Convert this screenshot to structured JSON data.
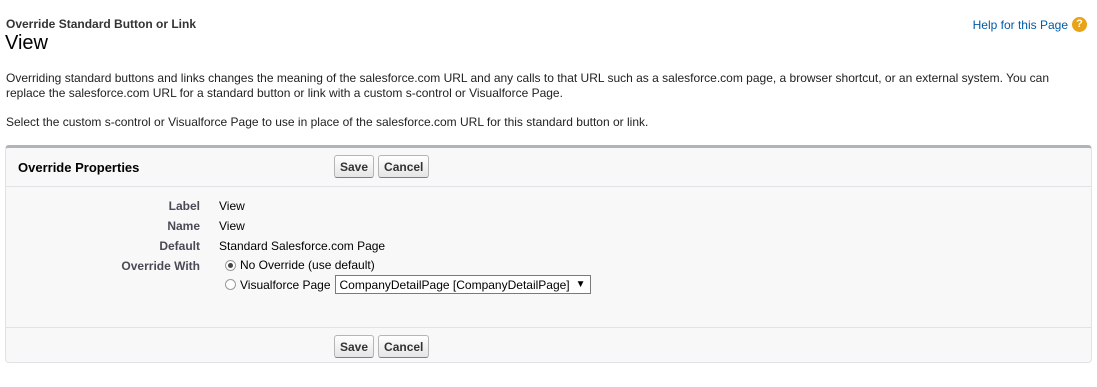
{
  "header": {
    "subtitle": "Override Standard Button or Link",
    "title": "View",
    "help_link": "Help for this Page",
    "help_icon": "question-circle-icon"
  },
  "description": {
    "paragraph1": "Overriding standard buttons and links changes the meaning of the salesforce.com URL and any calls to that URL such as a salesforce.com page, a browser shortcut, or an external system. You can replace the salesforce.com URL for a standard button or link with a custom s-control or Visualforce Page.",
    "paragraph2": "Select the custom s-control or Visualforce Page to use in place of the salesforce.com URL for this standard button or link."
  },
  "panel": {
    "title": "Override Properties",
    "save_label": "Save",
    "cancel_label": "Cancel",
    "fields": {
      "label_label": "Label",
      "label_value": "View",
      "name_label": "Name",
      "name_value": "View",
      "default_label": "Default",
      "default_value": "Standard Salesforce.com Page",
      "override_label": "Override With"
    },
    "options": {
      "no_override": "No Override (use default)",
      "visualforce": "Visualforce Page",
      "selected": "No Override (use default)"
    },
    "visualforce_select": {
      "value": "CompanyDetailPage [CompanyDetailPage]"
    }
  }
}
